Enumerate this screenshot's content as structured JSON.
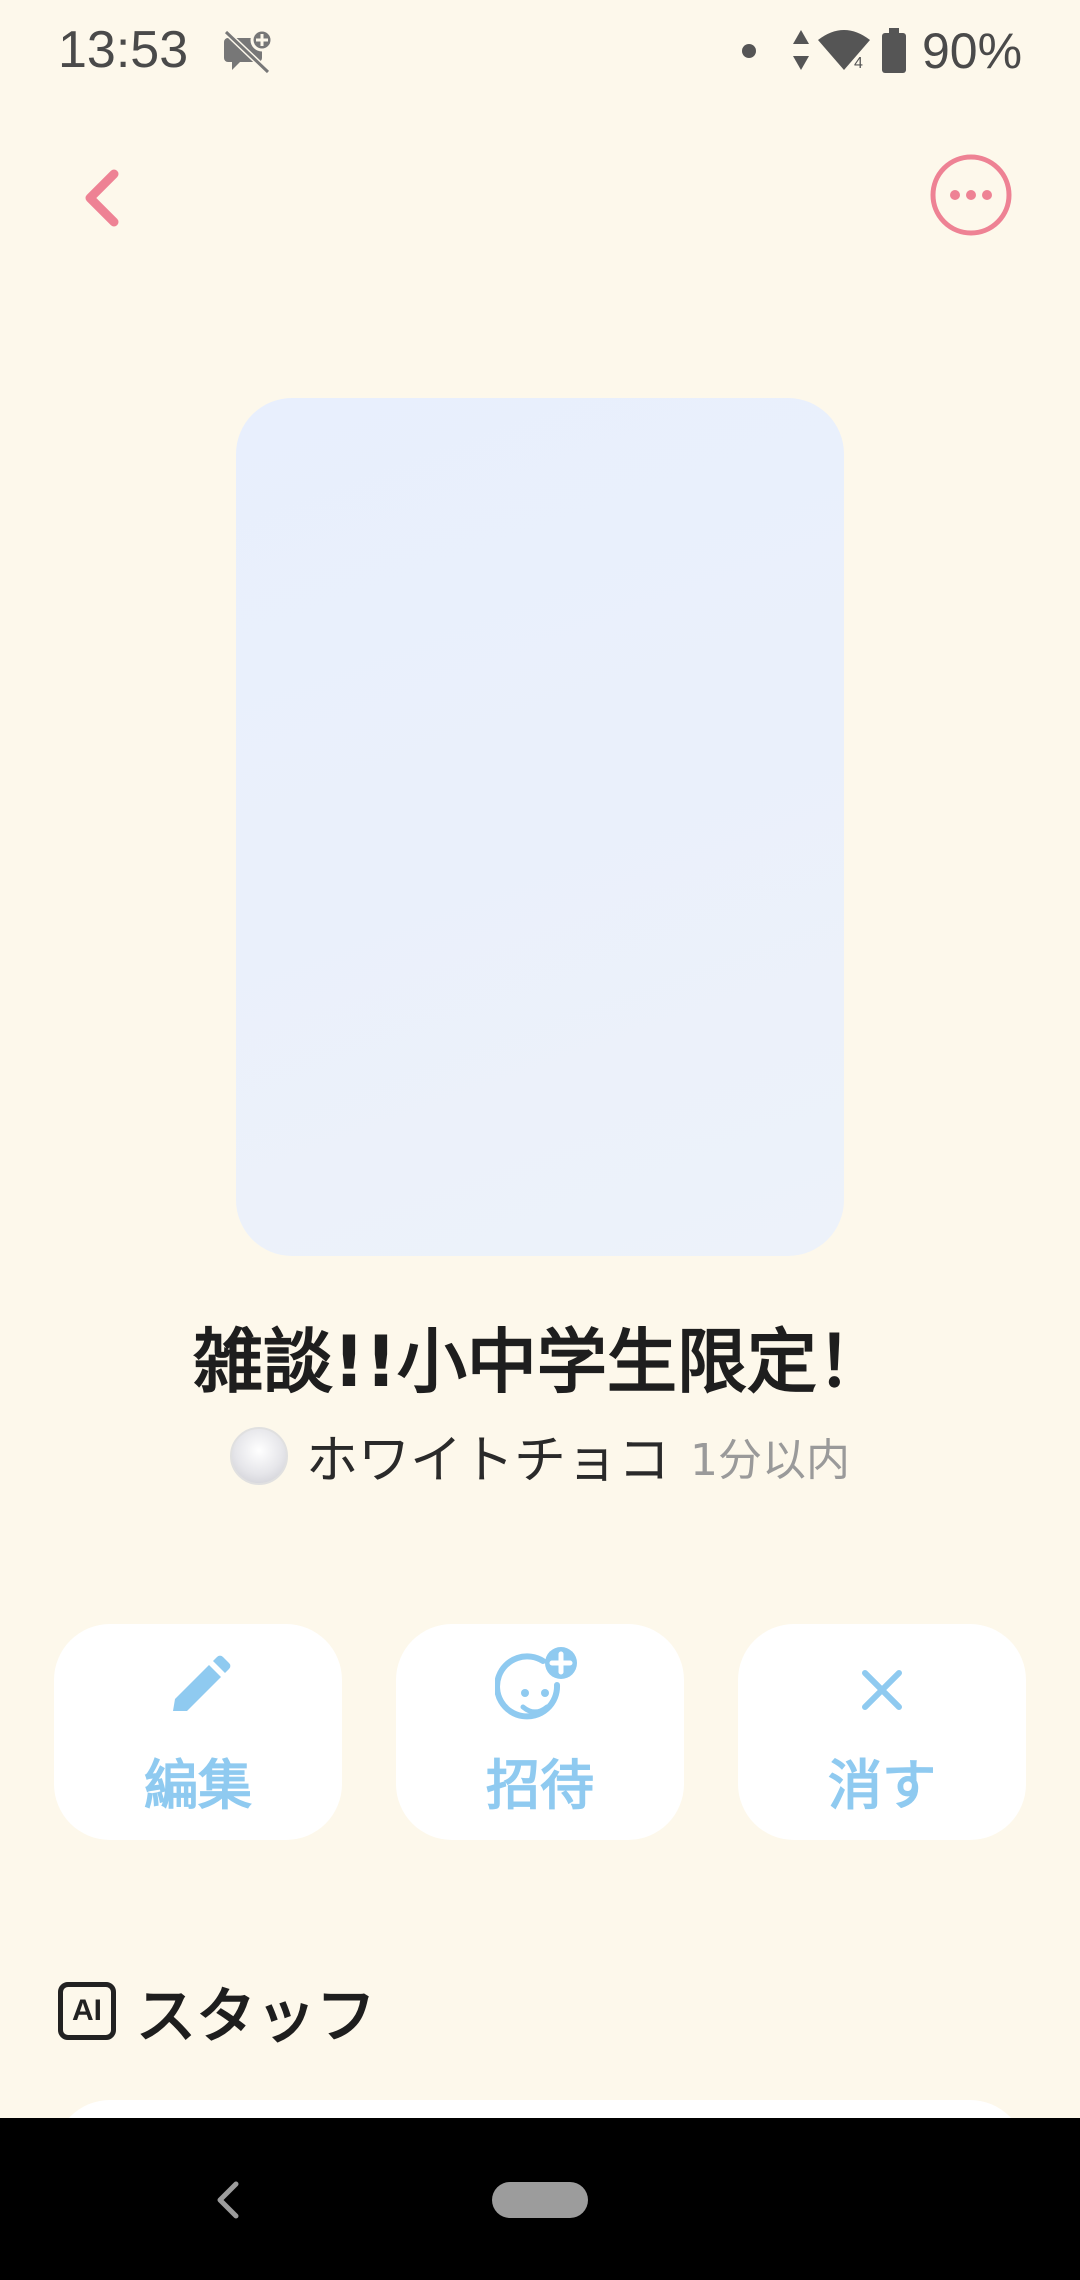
{
  "status_bar": {
    "time": "13:53",
    "battery": "90%",
    "icons": [
      "notification-muted-icon",
      "data-arrows-icon",
      "wifi-icon",
      "battery-icon"
    ]
  },
  "header": {
    "back_icon": "chevron-left-icon",
    "more_icon": "more-dots-icon",
    "accent_color": "#ee8294"
  },
  "room": {
    "title": "雑談!!小中学生限定！",
    "owner_name": "ホワイトチョコ",
    "posted_time": "1分以内"
  },
  "actions": [
    {
      "label": "編集",
      "icon": "pencil-icon"
    },
    {
      "label": "招待",
      "icon": "add-friend-icon"
    },
    {
      "label": "消す",
      "icon": "close-icon"
    }
  ],
  "actions_color": "#8fcaf0",
  "staff_section": {
    "badge": "AI",
    "title": "スタッフ"
  }
}
